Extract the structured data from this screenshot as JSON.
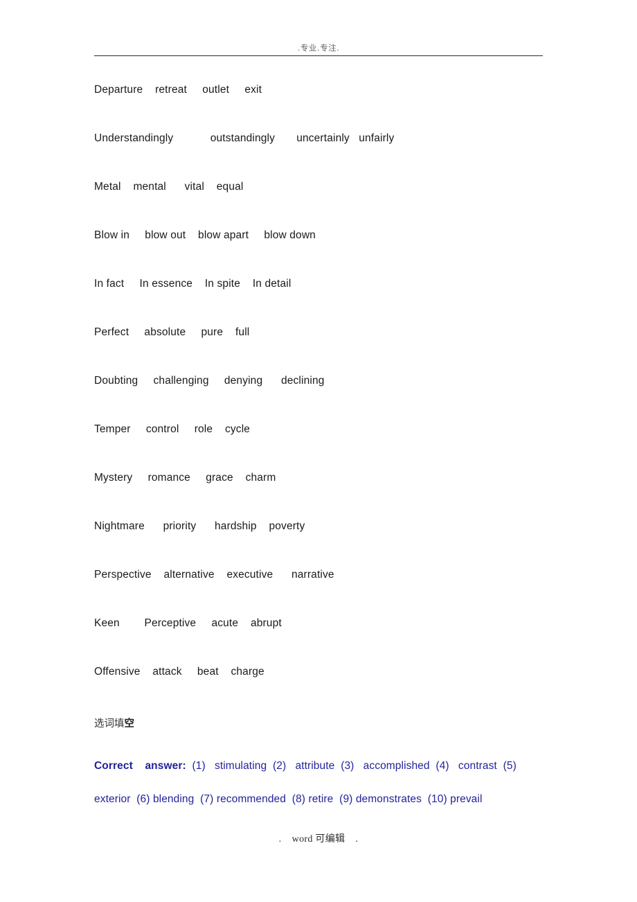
{
  "document": {
    "header_text": ".专业.专注.",
    "footer_text": ".    word 可编辑    ."
  },
  "colors": {
    "body_text": "#1a1a1a",
    "header_text": "#666666",
    "rule": "#2b2b33",
    "answer_blue": "#23239a"
  },
  "word_rows": [
    {
      "text": "Departure    retreat     outlet     exit"
    },
    {
      "text": "Understandingly            outstandingly       uncertainly   unfairly"
    },
    {
      "text": "Metal    mental      vital    equal"
    },
    {
      "text": "Blow in     blow out    blow apart     blow down"
    },
    {
      "text": "In fact     In essence    In spite    In detail"
    },
    {
      "text": "Perfect     absolute     pure    full"
    },
    {
      "text": "Doubting     challenging     denying      declining"
    },
    {
      "text": "Temper     control     role    cycle"
    },
    {
      "text": "Mystery     romance     grace    charm"
    },
    {
      "text": "Nightmare      priority      hardship    poverty"
    },
    {
      "text": "Perspective    alternative    executive      narrative"
    },
    {
      "text": "Keen        Perceptive     acute    abrupt"
    },
    {
      "text": "Offensive    attack     beat    charge"
    }
  ],
  "section": {
    "heading_prefix": "选词填",
    "heading_emph": "空"
  },
  "answers": {
    "lead_label": "Correct    answer:",
    "line1_rest": "  (1)   stimulating  (2)   attribute  (3)   accomplished  (4)   contrast  (5)",
    "line2": "exterior  (6) blending  (7) recommended  (8) retire  (9) demonstrates  (10) prevail",
    "items": [
      {
        "number": "(1)",
        "word": "stimulating"
      },
      {
        "number": "(2)",
        "word": "attribute"
      },
      {
        "number": "(3)",
        "word": "accomplished"
      },
      {
        "number": "(4)",
        "word": "contrast"
      },
      {
        "number": "(5)",
        "word": "exterior"
      },
      {
        "number": "(6)",
        "word": "blending"
      },
      {
        "number": "(7)",
        "word": "recommended"
      },
      {
        "number": "(8)",
        "word": "retire"
      },
      {
        "number": "(9)",
        "word": "demonstrates"
      },
      {
        "number": "(10)",
        "word": "prevail"
      }
    ]
  }
}
